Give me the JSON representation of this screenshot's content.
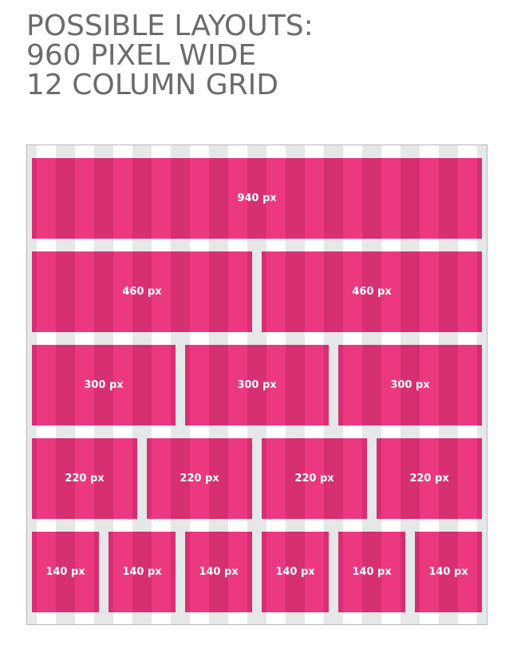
{
  "title": {
    "line1": "POSSIBLE LAYOUTS:",
    "line2": "960 PIXEL WIDE",
    "line3": "12 COLUMN GRID"
  },
  "grid": {
    "columns": 12,
    "rows": [
      {
        "spans": [
          12
        ],
        "labels": [
          "940 px"
        ]
      },
      {
        "spans": [
          6,
          6
        ],
        "labels": [
          "460 px",
          "460 px"
        ]
      },
      {
        "spans": [
          4,
          4,
          4
        ],
        "labels": [
          "300 px",
          "300 px",
          "300 px"
        ]
      },
      {
        "spans": [
          3,
          3,
          3,
          3
        ],
        "labels": [
          "220 px",
          "220 px",
          "220 px",
          "220 px"
        ]
      },
      {
        "spans": [
          2,
          2,
          2,
          2,
          2,
          2
        ],
        "labels": [
          "140 px",
          "140 px",
          "140 px",
          "140 px",
          "140 px",
          "140 px"
        ]
      }
    ]
  },
  "colors": {
    "block": "#d62f72",
    "column_highlight": "#ff408c",
    "gutter": "#e6e7e8",
    "title_text": "#6b6b6b"
  }
}
